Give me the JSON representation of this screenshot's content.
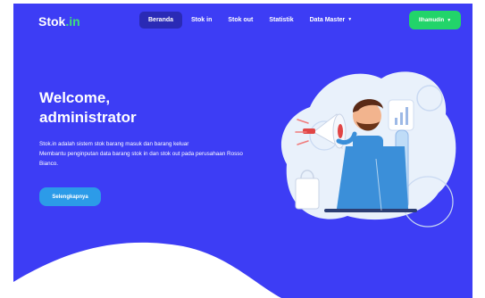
{
  "brand": {
    "name": "Stok",
    "suffix": ".in"
  },
  "nav": {
    "items": [
      {
        "label": "Beranda",
        "active": true
      },
      {
        "label": "Stok in"
      },
      {
        "label": "Stok out"
      },
      {
        "label": "Statistik"
      },
      {
        "label": "Data Master"
      }
    ]
  },
  "user": {
    "name": "Ilhamudin"
  },
  "hero": {
    "title_line1": "Welcome,",
    "title_line2": "administrator",
    "desc_line1": "Stok.in adalah sistem stok barang masuk dan barang keluar",
    "desc_line2": "Membantu penginputan data barang stok in dan stok out pada perusahaan Rosso Bianco.",
    "cta_label": "Selengkapnya"
  },
  "icons": {
    "caret": "caret-down-icon",
    "illustration": "megaphone-man-illustration"
  },
  "colors": {
    "background": "#3d3df5",
    "active_nav": "#2a2ab5",
    "user_button": "#22d46a",
    "cta": "#2c9be8",
    "brand_accent": "#3ee07a"
  }
}
